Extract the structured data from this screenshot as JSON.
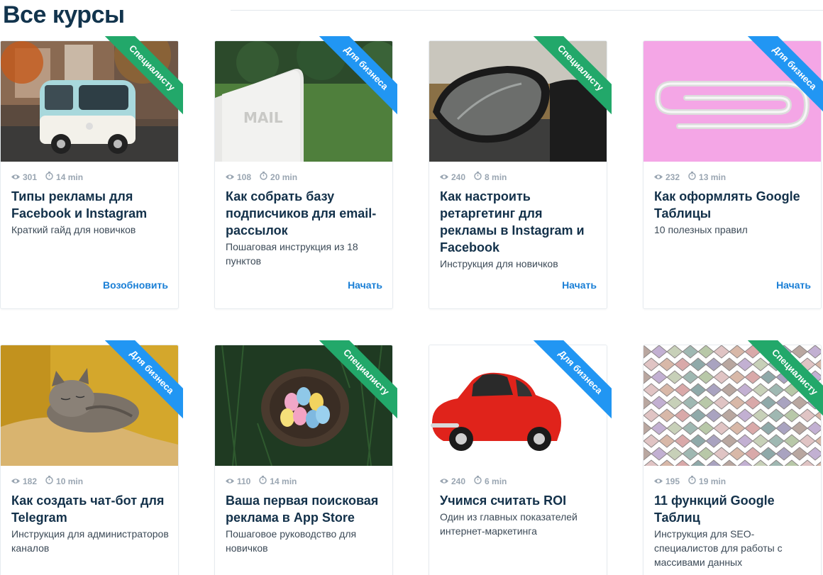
{
  "page": {
    "title": "Все курсы"
  },
  "colors": {
    "accent": "#1a7fd6",
    "ribbon_green": "#22a86a",
    "ribbon_blue": "#2196f3"
  },
  "courses": [
    {
      "ribbon": "Специалисту",
      "ribbon_color": "green",
      "views": "301",
      "duration": "14 min",
      "title": "Типы рекламы для Facebook и Instagram",
      "subtitle": "Краткий гайд для новичков",
      "action": "Возобновить",
      "image": "vw-van"
    },
    {
      "ribbon": "Для бизнеса",
      "ribbon_color": "blue",
      "views": "108",
      "duration": "20 min",
      "title": "Как собрать базу подписчиков для email-рассылок",
      "subtitle": "Пошаговая инструкция из 18 пунктов",
      "action": "Начать",
      "image": "mailbox"
    },
    {
      "ribbon": "Специалисту",
      "ribbon_color": "green",
      "views": "240",
      "duration": "8 min",
      "title": "Как настроить ретаргетинг для рекламы в Instagram и Facebook",
      "subtitle": "Инструкция для новичков",
      "action": "Начать",
      "image": "car-mirror"
    },
    {
      "ribbon": "Для бизнеса",
      "ribbon_color": "blue",
      "views": "232",
      "duration": "13 min",
      "title": "Как оформлять Google Таблицы",
      "subtitle": "10 полезных правил",
      "action": "Начать",
      "image": "paperclip"
    },
    {
      "ribbon": "Для бизнеса",
      "ribbon_color": "blue",
      "views": "182",
      "duration": "10 min",
      "title": "Как создать чат-бот для Telegram",
      "subtitle": "Инструкция для администраторов каналов",
      "action": "",
      "image": "cat"
    },
    {
      "ribbon": "Специалисту",
      "ribbon_color": "green",
      "views": "110",
      "duration": "14 min",
      "title": "Ваша первая поисковая реклама в App Store",
      "subtitle": "Пошаговое руководство для новичков",
      "action": "",
      "image": "eggs-nest"
    },
    {
      "ribbon": "Для бизнеса",
      "ribbon_color": "blue",
      "views": "240",
      "duration": "6 min",
      "title": "Учимся считать ROI",
      "subtitle": "Один из главных показателей интернет-маркетинга",
      "action": "",
      "image": "red-car"
    },
    {
      "ribbon": "Специалисту",
      "ribbon_color": "green",
      "views": "195",
      "duration": "19 min",
      "title": "11 функций Google Таблиц",
      "subtitle": "Инструкция для SEO-специалистов для работы с массивами данных",
      "action": "",
      "image": "tiles"
    }
  ]
}
